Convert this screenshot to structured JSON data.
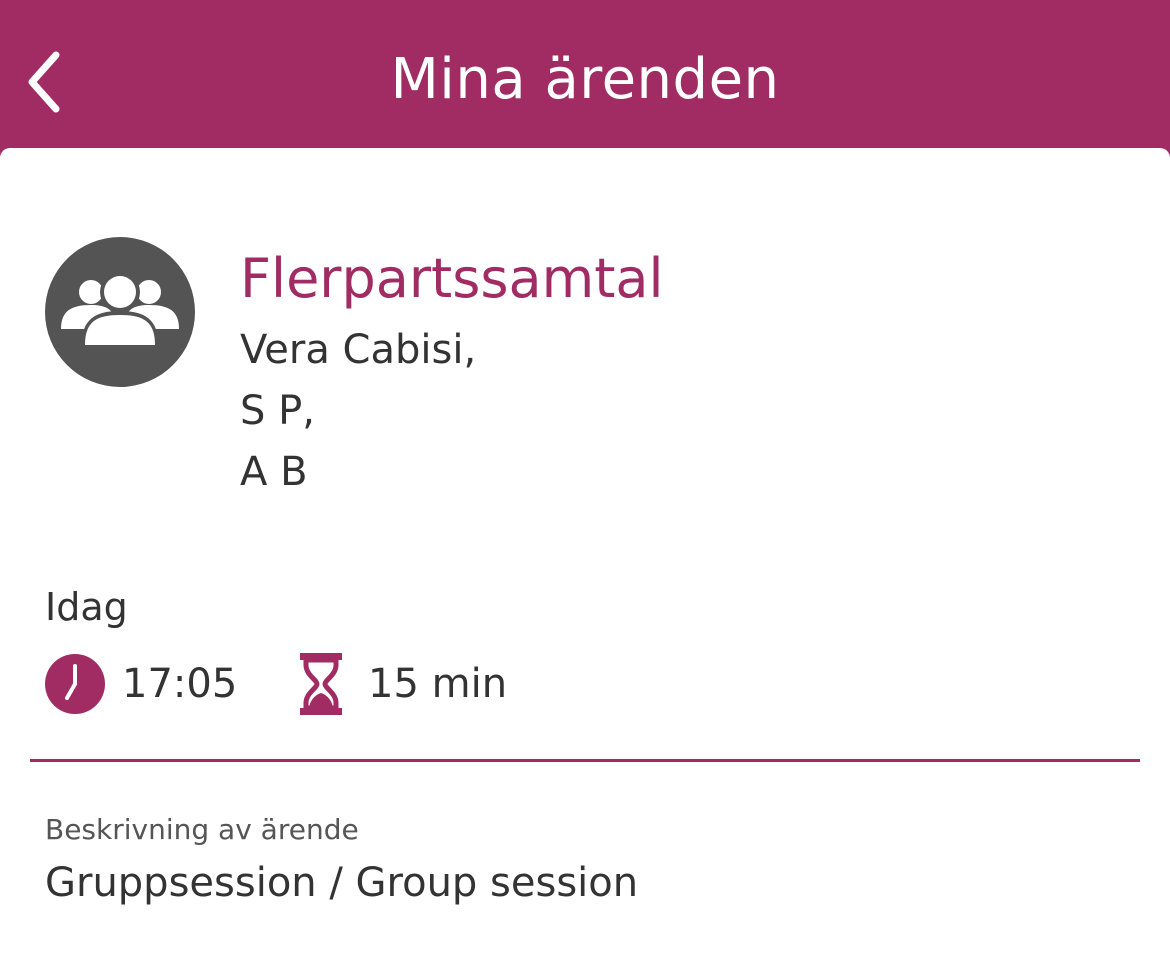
{
  "header": {
    "title": "Mina ärenden",
    "back_icon": "chevron-left-icon"
  },
  "case": {
    "avatar_icon": "group-icon",
    "title": "Flerpartssamtal",
    "participants": [
      "Vera Cabisi,",
      "S P,",
      "A B"
    ],
    "day": "Idag",
    "time": "17:05",
    "time_icon": "clock-icon",
    "duration": "15 min",
    "duration_icon": "hourglass-icon",
    "description_label": "Beskrivning av ärende",
    "description": "Gruppsession / Group session"
  },
  "colors": {
    "brand": "#a12c63",
    "avatar_bg": "#545454",
    "text": "#333333",
    "background": "#ffffff"
  }
}
